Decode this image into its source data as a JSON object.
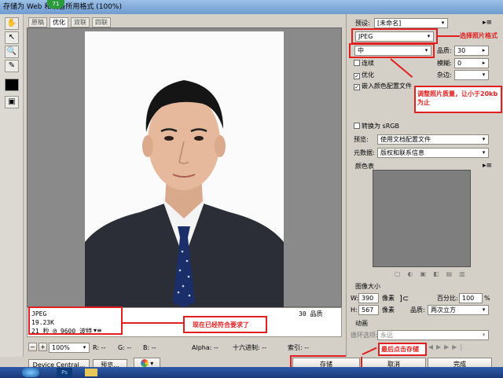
{
  "window": {
    "title": "存储为 Web 和设备所用格式 (100%)",
    "badge": "71"
  },
  "tabs": [
    {
      "label": "原稿"
    },
    {
      "label": "优化"
    },
    {
      "label": "双联"
    },
    {
      "label": "四联"
    }
  ],
  "info": {
    "format": "JPEG",
    "size": "19.23K",
    "time": "21 秒 @ 9600 波特",
    "quality_label": "30 品质"
  },
  "annotations": {
    "choose_format": "选择照片格式",
    "adjust_quality": "调整照片质量，让小于20kb为止",
    "now_meets": "现在已经符合要求了",
    "finally_save": "最后点击存储"
  },
  "status": {
    "zoom": "100%",
    "r": "R: --",
    "g": "G: --",
    "b": "B: --",
    "alpha": "Alpha: --",
    "hex": "十六进制: --",
    "index": "索引: --"
  },
  "buttons": {
    "device_central": "Device Central...",
    "preview": "预览...",
    "save": "存储",
    "cancel": "取消",
    "done": "完成"
  },
  "settings": {
    "preset_label": "预设:",
    "preset_value": "[未命名]",
    "format": "JPEG",
    "quality_level": "中",
    "quality_label": "品质:",
    "quality_value": "30",
    "progressive_label": "连续",
    "blur_label": "模糊:",
    "blur_value": "0",
    "optimized_label": "优化",
    "matte_label": "杂边:",
    "embed_profile_label": "嵌入颜色配置文件",
    "convert_srgb_label": "转换为 sRGB",
    "preview_label": "预览:",
    "preview_value": "使用文档配置文件",
    "metadata_label": "元数据:",
    "metadata_value": "版权和联系信息"
  },
  "color_table": {
    "title": "颜色表"
  },
  "image_size": {
    "title": "图像大小",
    "w_label": "W:",
    "w_value": "390",
    "h_label": "H:",
    "h_value": "567",
    "unit": "像素",
    "percent_label": "百分比:",
    "percent_value": "100",
    "percent_unit": "%",
    "quality_label": "品质:",
    "quality_value": "两次立方"
  },
  "animation": {
    "title": "动画",
    "loop_label": "循环选项:",
    "loop_value": "永远"
  }
}
